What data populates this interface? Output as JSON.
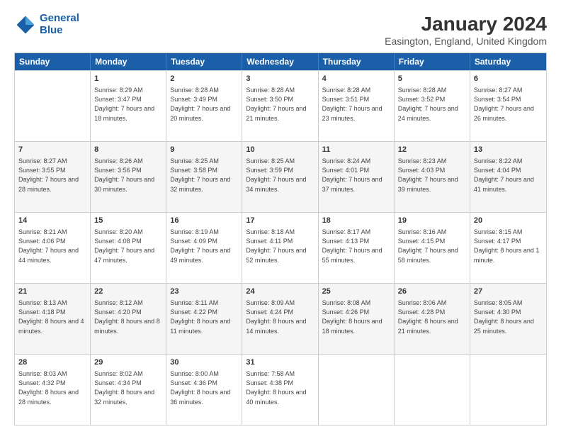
{
  "logo": {
    "line1": "General",
    "line2": "Blue"
  },
  "title": "January 2024",
  "location": "Easington, England, United Kingdom",
  "days": [
    "Sunday",
    "Monday",
    "Tuesday",
    "Wednesday",
    "Thursday",
    "Friday",
    "Saturday"
  ],
  "rows": [
    [
      {
        "num": "",
        "sunrise": "",
        "sunset": "",
        "daylight": ""
      },
      {
        "num": "1",
        "sunrise": "Sunrise: 8:29 AM",
        "sunset": "Sunset: 3:47 PM",
        "daylight": "Daylight: 7 hours and 18 minutes."
      },
      {
        "num": "2",
        "sunrise": "Sunrise: 8:28 AM",
        "sunset": "Sunset: 3:49 PM",
        "daylight": "Daylight: 7 hours and 20 minutes."
      },
      {
        "num": "3",
        "sunrise": "Sunrise: 8:28 AM",
        "sunset": "Sunset: 3:50 PM",
        "daylight": "Daylight: 7 hours and 21 minutes."
      },
      {
        "num": "4",
        "sunrise": "Sunrise: 8:28 AM",
        "sunset": "Sunset: 3:51 PM",
        "daylight": "Daylight: 7 hours and 23 minutes."
      },
      {
        "num": "5",
        "sunrise": "Sunrise: 8:28 AM",
        "sunset": "Sunset: 3:52 PM",
        "daylight": "Daylight: 7 hours and 24 minutes."
      },
      {
        "num": "6",
        "sunrise": "Sunrise: 8:27 AM",
        "sunset": "Sunset: 3:54 PM",
        "daylight": "Daylight: 7 hours and 26 minutes."
      }
    ],
    [
      {
        "num": "7",
        "sunrise": "Sunrise: 8:27 AM",
        "sunset": "Sunset: 3:55 PM",
        "daylight": "Daylight: 7 hours and 28 minutes."
      },
      {
        "num": "8",
        "sunrise": "Sunrise: 8:26 AM",
        "sunset": "Sunset: 3:56 PM",
        "daylight": "Daylight: 7 hours and 30 minutes."
      },
      {
        "num": "9",
        "sunrise": "Sunrise: 8:25 AM",
        "sunset": "Sunset: 3:58 PM",
        "daylight": "Daylight: 7 hours and 32 minutes."
      },
      {
        "num": "10",
        "sunrise": "Sunrise: 8:25 AM",
        "sunset": "Sunset: 3:59 PM",
        "daylight": "Daylight: 7 hours and 34 minutes."
      },
      {
        "num": "11",
        "sunrise": "Sunrise: 8:24 AM",
        "sunset": "Sunset: 4:01 PM",
        "daylight": "Daylight: 7 hours and 37 minutes."
      },
      {
        "num": "12",
        "sunrise": "Sunrise: 8:23 AM",
        "sunset": "Sunset: 4:03 PM",
        "daylight": "Daylight: 7 hours and 39 minutes."
      },
      {
        "num": "13",
        "sunrise": "Sunrise: 8:22 AM",
        "sunset": "Sunset: 4:04 PM",
        "daylight": "Daylight: 7 hours and 41 minutes."
      }
    ],
    [
      {
        "num": "14",
        "sunrise": "Sunrise: 8:21 AM",
        "sunset": "Sunset: 4:06 PM",
        "daylight": "Daylight: 7 hours and 44 minutes."
      },
      {
        "num": "15",
        "sunrise": "Sunrise: 8:20 AM",
        "sunset": "Sunset: 4:08 PM",
        "daylight": "Daylight: 7 hours and 47 minutes."
      },
      {
        "num": "16",
        "sunrise": "Sunrise: 8:19 AM",
        "sunset": "Sunset: 4:09 PM",
        "daylight": "Daylight: 7 hours and 49 minutes."
      },
      {
        "num": "17",
        "sunrise": "Sunrise: 8:18 AM",
        "sunset": "Sunset: 4:11 PM",
        "daylight": "Daylight: 7 hours and 52 minutes."
      },
      {
        "num": "18",
        "sunrise": "Sunrise: 8:17 AM",
        "sunset": "Sunset: 4:13 PM",
        "daylight": "Daylight: 7 hours and 55 minutes."
      },
      {
        "num": "19",
        "sunrise": "Sunrise: 8:16 AM",
        "sunset": "Sunset: 4:15 PM",
        "daylight": "Daylight: 7 hours and 58 minutes."
      },
      {
        "num": "20",
        "sunrise": "Sunrise: 8:15 AM",
        "sunset": "Sunset: 4:17 PM",
        "daylight": "Daylight: 8 hours and 1 minute."
      }
    ],
    [
      {
        "num": "21",
        "sunrise": "Sunrise: 8:13 AM",
        "sunset": "Sunset: 4:18 PM",
        "daylight": "Daylight: 8 hours and 4 minutes."
      },
      {
        "num": "22",
        "sunrise": "Sunrise: 8:12 AM",
        "sunset": "Sunset: 4:20 PM",
        "daylight": "Daylight: 8 hours and 8 minutes."
      },
      {
        "num": "23",
        "sunrise": "Sunrise: 8:11 AM",
        "sunset": "Sunset: 4:22 PM",
        "daylight": "Daylight: 8 hours and 11 minutes."
      },
      {
        "num": "24",
        "sunrise": "Sunrise: 8:09 AM",
        "sunset": "Sunset: 4:24 PM",
        "daylight": "Daylight: 8 hours and 14 minutes."
      },
      {
        "num": "25",
        "sunrise": "Sunrise: 8:08 AM",
        "sunset": "Sunset: 4:26 PM",
        "daylight": "Daylight: 8 hours and 18 minutes."
      },
      {
        "num": "26",
        "sunrise": "Sunrise: 8:06 AM",
        "sunset": "Sunset: 4:28 PM",
        "daylight": "Daylight: 8 hours and 21 minutes."
      },
      {
        "num": "27",
        "sunrise": "Sunrise: 8:05 AM",
        "sunset": "Sunset: 4:30 PM",
        "daylight": "Daylight: 8 hours and 25 minutes."
      }
    ],
    [
      {
        "num": "28",
        "sunrise": "Sunrise: 8:03 AM",
        "sunset": "Sunset: 4:32 PM",
        "daylight": "Daylight: 8 hours and 28 minutes."
      },
      {
        "num": "29",
        "sunrise": "Sunrise: 8:02 AM",
        "sunset": "Sunset: 4:34 PM",
        "daylight": "Daylight: 8 hours and 32 minutes."
      },
      {
        "num": "30",
        "sunrise": "Sunrise: 8:00 AM",
        "sunset": "Sunset: 4:36 PM",
        "daylight": "Daylight: 8 hours and 36 minutes."
      },
      {
        "num": "31",
        "sunrise": "Sunrise: 7:58 AM",
        "sunset": "Sunset: 4:38 PM",
        "daylight": "Daylight: 8 hours and 40 minutes."
      },
      {
        "num": "",
        "sunrise": "",
        "sunset": "",
        "daylight": ""
      },
      {
        "num": "",
        "sunrise": "",
        "sunset": "",
        "daylight": ""
      },
      {
        "num": "",
        "sunrise": "",
        "sunset": "",
        "daylight": ""
      }
    ]
  ]
}
